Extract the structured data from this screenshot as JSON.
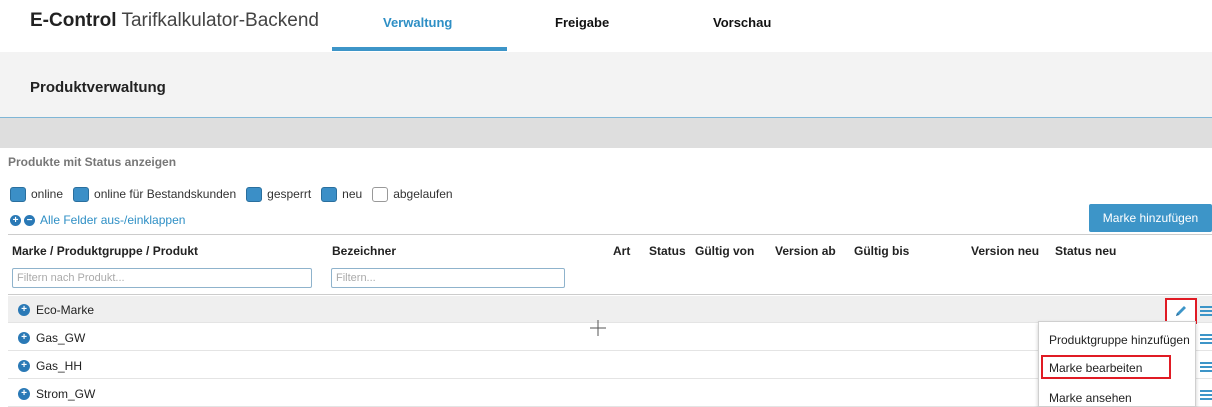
{
  "app": {
    "brand_bold": "E-Control",
    "brand_rest": "Tarifkalkulator-Backend"
  },
  "nav": {
    "tabs": [
      {
        "label": "Verwaltung",
        "active": true
      },
      {
        "label": "Freigabe",
        "active": false
      },
      {
        "label": "Vorschau",
        "active": false
      }
    ]
  },
  "page": {
    "title": "Produktverwaltung"
  },
  "filters": {
    "section_label": "Produkte mit Status anzeigen",
    "status": [
      {
        "label": "online",
        "checked": true
      },
      {
        "label": "online für Bestandskunden",
        "checked": true
      },
      {
        "label": "gesperrt",
        "checked": true
      },
      {
        "label": "neu",
        "checked": true
      },
      {
        "label": "abgelaufen",
        "checked": false
      }
    ],
    "expand_all_label": "Alle Felder aus-/einklappen"
  },
  "actions": {
    "add_brand": "Marke hinzufügen"
  },
  "table": {
    "columns": [
      "Marke / Produktgruppe / Produkt",
      "Bezeichner",
      "Art",
      "Status",
      "Gültig von",
      "Version ab",
      "Gültig bis",
      "Version neu",
      "Status neu"
    ],
    "filter_product_placeholder": "Filtern nach Produkt...",
    "filter_identifier_placeholder": "Filtern...",
    "rows": [
      {
        "label": "Eco-Marke"
      },
      {
        "label": "Gas_GW"
      },
      {
        "label": "Gas_HH"
      },
      {
        "label": "Strom_GW"
      }
    ]
  },
  "context_menu": {
    "items": [
      "Produktgruppe hinzufügen",
      "Marke bearbeiten",
      "Marke ansehen"
    ],
    "highlighted": "Marke bearbeiten"
  },
  "colors": {
    "accent": "#3d95c8",
    "highlight_border": "#e01b24"
  }
}
